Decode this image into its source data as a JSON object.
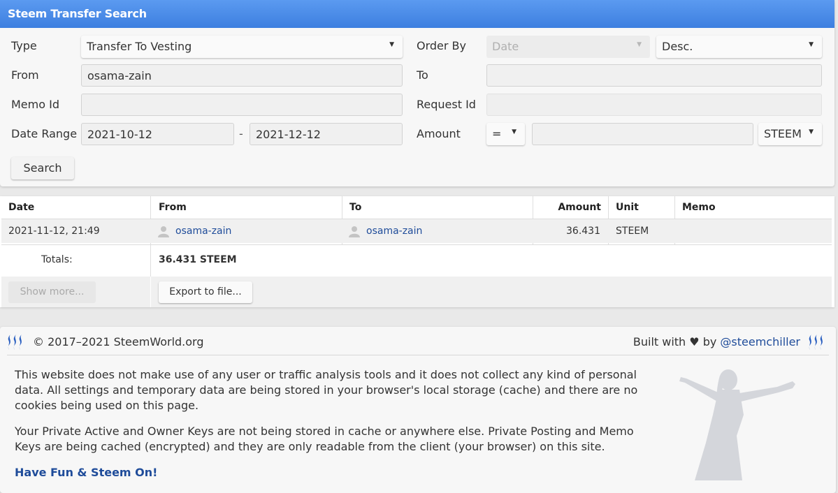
{
  "header": {
    "title": "Steem Transfer Search"
  },
  "form": {
    "type_label": "Type",
    "type_value": "Transfer To Vesting",
    "order_by_label": "Order By",
    "order_by_value": "Date",
    "order_dir_value": "Desc.",
    "from_label": "From",
    "from_value": "osama-zain",
    "to_label": "To",
    "to_value": "",
    "memo_id_label": "Memo Id",
    "memo_id_value": "",
    "request_id_label": "Request Id",
    "request_id_value": "",
    "date_range_label": "Date Range",
    "date_from": "2021-10-12",
    "date_separator": "-",
    "date_to": "2021-12-12",
    "amount_label": "Amount",
    "amount_op": "=",
    "amount_value": "",
    "amount_unit": "STEEM",
    "search_button": "Search"
  },
  "table": {
    "columns": [
      "Date",
      "From",
      "To",
      "Amount",
      "Unit",
      "Memo"
    ],
    "rows": [
      {
        "date": "2021-11-12, 21:49",
        "from": "osama-zain",
        "to": "osama-zain",
        "amount": "36.431",
        "unit": "STEEM",
        "memo": ""
      }
    ],
    "totals_label": "Totals:",
    "totals_value": "36.431 STEEM",
    "show_more_button": "Show more...",
    "export_button": "Export to file..."
  },
  "footer": {
    "copyright": "© 2017–2021 SteemWorld.org",
    "built_with_prefix": "Built with ♥ by",
    "built_with_user": "@steemchiller",
    "privacy_text": "This website does not make use of any user or traffic analysis tools and it does not collect any kind of personal data. All settings and temporary data are being stored in your browser's local storage (cache) and there are no cookies being used on this page.",
    "keys_text": "Your Private Active and Owner Keys are not being stored in cache or anywhere else. Private Posting and Memo Keys are being cached (encrypted) and they are only readable from the client (your browser) on this site.",
    "slogan": "Have Fun & Steem On!"
  },
  "colors": {
    "header_blue": "#3d7fe0",
    "link_blue": "#1f4c9a",
    "logo_blue": "#2a5fc0"
  },
  "icons": [
    "chevron-down-icon",
    "user-icon",
    "steem-logo-icon",
    "heart-icon"
  ]
}
